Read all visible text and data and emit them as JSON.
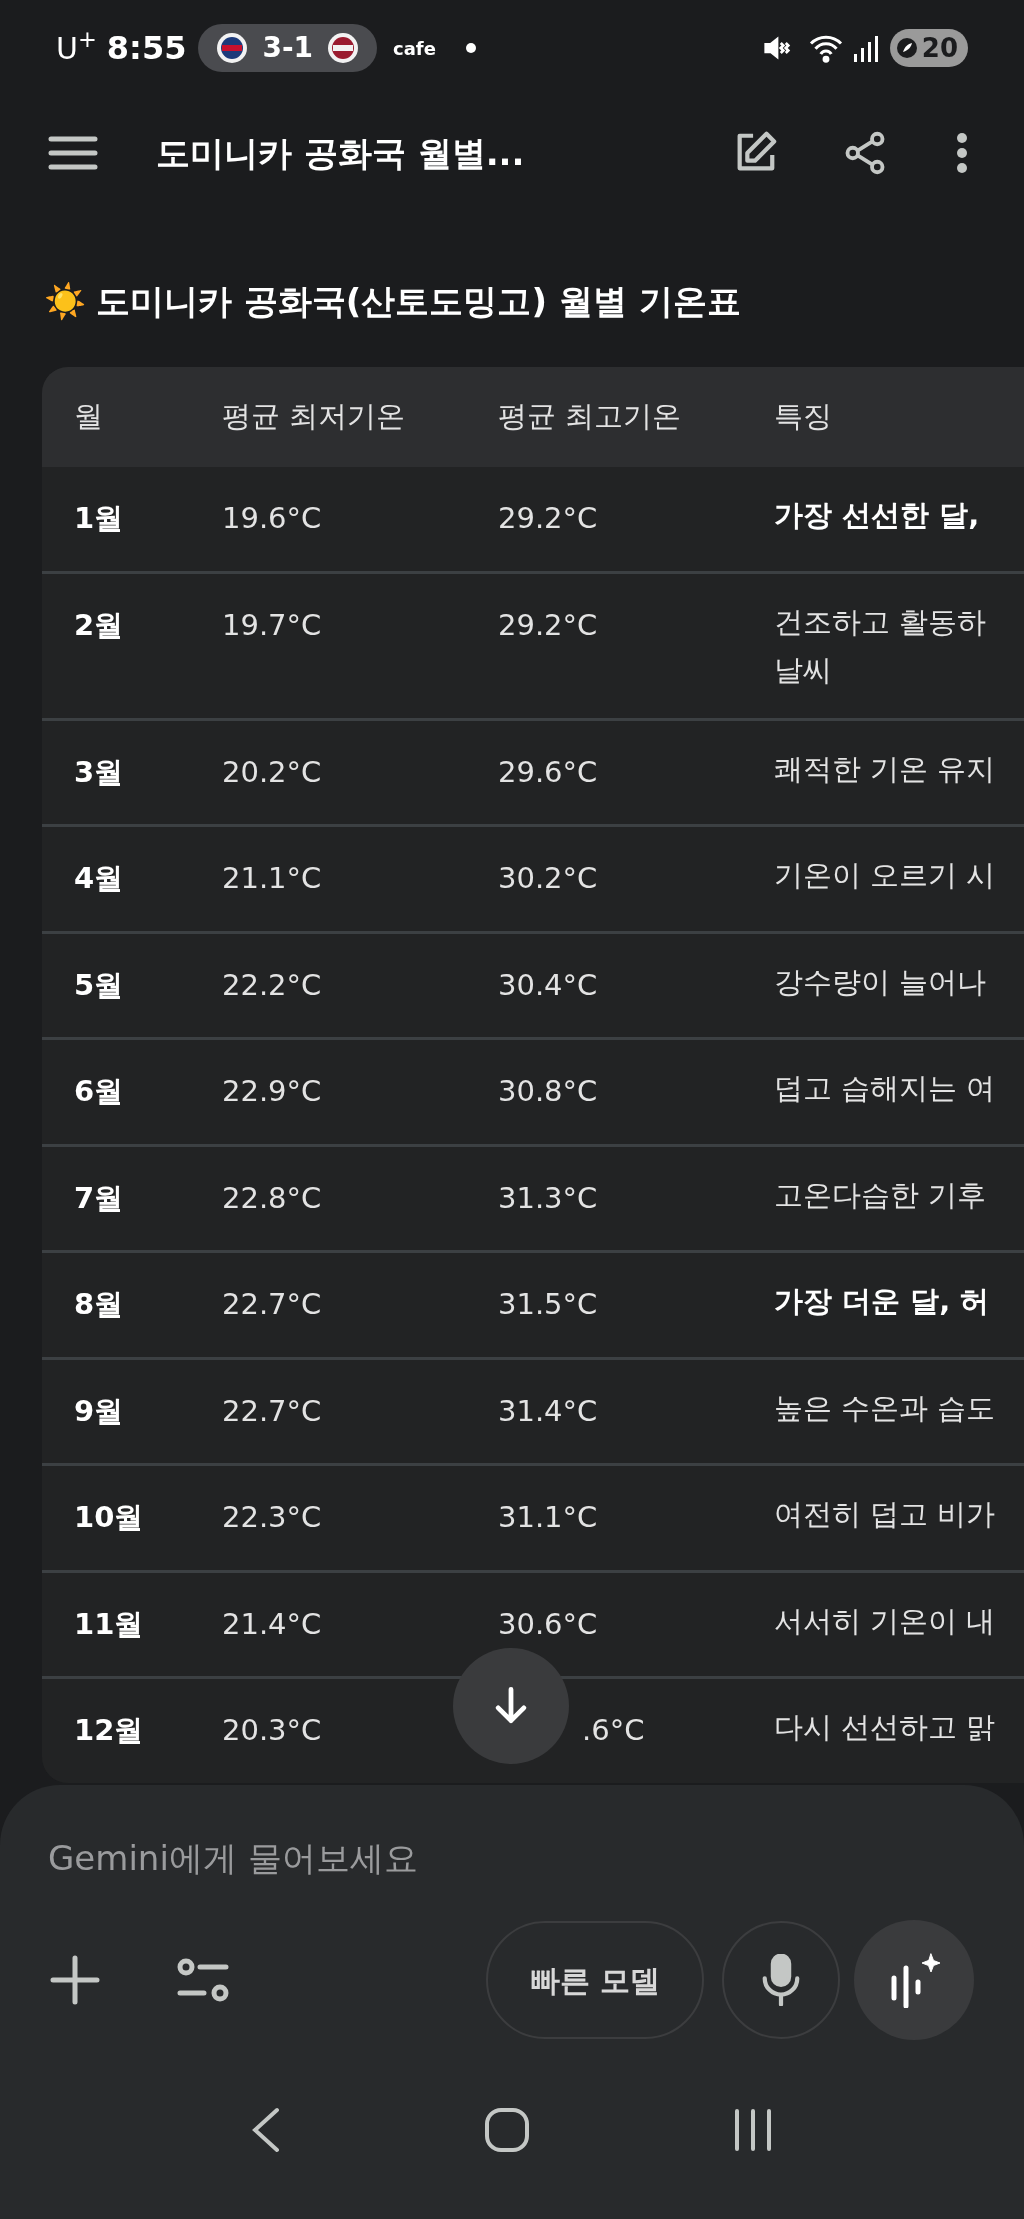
{
  "status_bar": {
    "carrier": "U$^{+}$",
    "time": "8:55",
    "score": "3-1",
    "app": "cafe",
    "battery": "20"
  },
  "header": {
    "title": "도미니카 공화국 월별..."
  },
  "heading": {
    "emoji": "☀️",
    "text": "도미니카 공화국(산토도밍고) 월별 기온표"
  },
  "table": {
    "columns": [
      "월",
      "평균 최저기온",
      "평균 최고기온",
      "특징"
    ],
    "rows": [
      {
        "month": "1월",
        "min": "19.6°C",
        "max": "29.2°C",
        "note": "가장 선선한 달,",
        "bold": true
      },
      {
        "month": "2월",
        "min": "19.7°C",
        "max": "29.2°C",
        "note": "건조하고 활동하\n날씨",
        "bold": false
      },
      {
        "month": "3월",
        "min": "20.2°C",
        "max": "29.6°C",
        "note": "쾌적한 기온 유지",
        "bold": false
      },
      {
        "month": "4월",
        "min": "21.1°C",
        "max": "30.2°C",
        "note": "기온이 오르기 시",
        "bold": false
      },
      {
        "month": "5월",
        "min": "22.2°C",
        "max": "30.4°C",
        "note": "강수량이 늘어나",
        "bold": false
      },
      {
        "month": "6월",
        "min": "22.9°C",
        "max": "30.8°C",
        "note": "덥고 습해지는 여",
        "bold": false
      },
      {
        "month": "7월",
        "min": "22.8°C",
        "max": "31.3°C",
        "note": "고온다습한 기후",
        "bold": false
      },
      {
        "month": "8월",
        "min": "22.7°C",
        "max": "31.5°C",
        "note": "가장 더운 달, 허",
        "bold": true
      },
      {
        "month": "9월",
        "min": "22.7°C",
        "max": "31.4°C",
        "note": "높은 수온과 습도",
        "bold": false
      },
      {
        "month": "10월",
        "min": "22.3°C",
        "max": "31.1°C",
        "note": "여전히 덥고 비가",
        "bold": false
      },
      {
        "month": "11월",
        "min": "21.4°C",
        "max": "30.6°C",
        "note": "서서히 기온이 내",
        "bold": false
      },
      {
        "month": "12월",
        "min": "20.3°C",
        "max": ".6°C",
        "note": "다시 선선하고 맑",
        "bold": false
      }
    ]
  },
  "composer": {
    "placeholder": "Gemini에게 물어보세요",
    "model_button": "빠른 모델"
  }
}
